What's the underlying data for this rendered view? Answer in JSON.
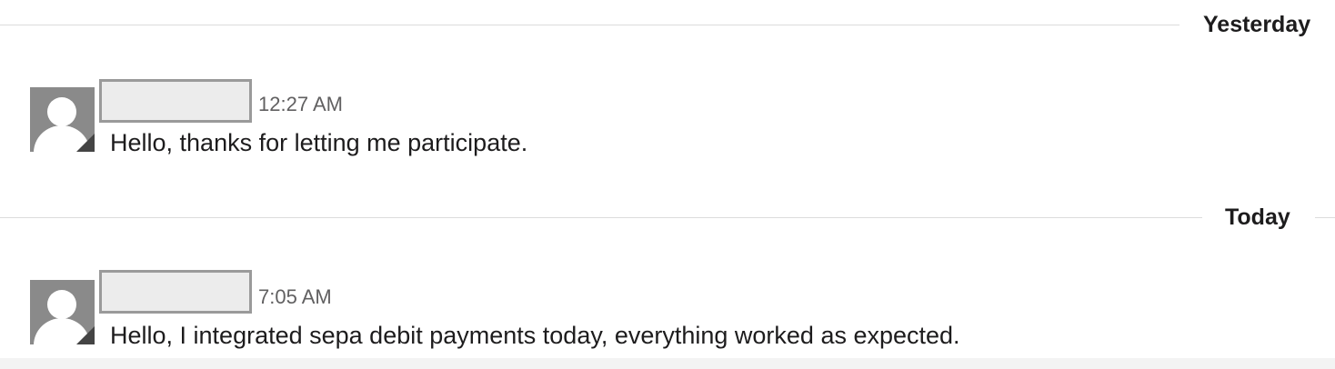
{
  "dividers": {
    "yesterday": "Yesterday",
    "today": "Today"
  },
  "messages": [
    {
      "sender_name": "",
      "time": "12:27 AM",
      "text": "Hello, thanks for letting me participate."
    },
    {
      "sender_name": "",
      "time": "7:05 AM",
      "text": "Hello, I integrated sepa debit payments today, everything worked as expected."
    }
  ],
  "icons": {
    "avatar": "user-avatar-icon",
    "status": "status-badge-icon"
  },
  "colors": {
    "divider_line": "#dcdcdc",
    "avatar_bg": "#8a8a8a",
    "name_redaction_fill": "#ececec",
    "name_redaction_border": "#9a9a9a",
    "timestamp": "#616061",
    "text": "#1d1c1d"
  }
}
